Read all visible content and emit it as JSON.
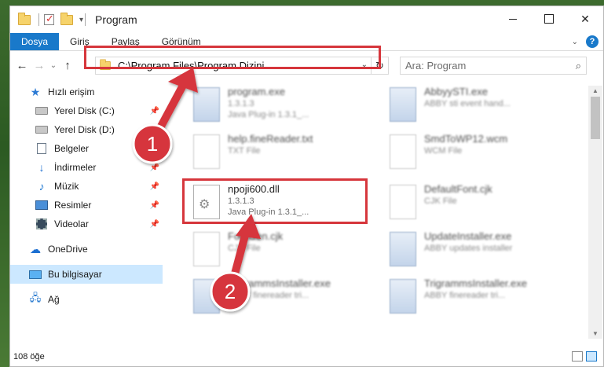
{
  "window": {
    "title": "Program"
  },
  "ribbon": {
    "tabs": [
      {
        "label": "Dosya"
      },
      {
        "label": "Giriş"
      },
      {
        "label": "Paylaş"
      },
      {
        "label": "Görünüm"
      }
    ]
  },
  "address": {
    "path": "C:\\Program Files\\Program Dizini"
  },
  "search": {
    "placeholder": "Ara: Program"
  },
  "navpane": {
    "items": [
      {
        "label": "Hızlı erişim",
        "icon": "star-icon"
      },
      {
        "label": "Yerel Disk (C:)",
        "icon": "drive-icon"
      },
      {
        "label": "Yerel Disk (D:)",
        "icon": "drive-icon"
      },
      {
        "label": "Belgeler",
        "icon": "document-icon"
      },
      {
        "label": "İndirmeler",
        "icon": "download-icon"
      },
      {
        "label": "Müzik",
        "icon": "music-icon"
      },
      {
        "label": "Resimler",
        "icon": "pictures-icon"
      },
      {
        "label": "Videolar",
        "icon": "video-icon"
      },
      {
        "label": "OneDrive",
        "icon": "cloud-icon"
      },
      {
        "label": "Bu bilgisayar",
        "icon": "computer-icon"
      },
      {
        "label": "Ağ",
        "icon": "network-icon"
      }
    ]
  },
  "files": [
    {
      "name": "program.exe",
      "line2": "1.3.1.3",
      "line3": "Java Plug-in 1.3.1_...",
      "blurred": true
    },
    {
      "name": "AbbyySTI.exe",
      "line2": "ABBY sti event hand...",
      "line3": "",
      "blurred": true
    },
    {
      "name": "help.fineReader.txt",
      "line2": "TXT File",
      "line3": "",
      "blurred": true
    },
    {
      "name": "SmdToWP12.wcm",
      "line2": "WCM File",
      "line3": "",
      "blurred": true
    },
    {
      "name": "npoji600.dll",
      "line2": "1.3.1.3",
      "line3": "Java Plug-in 1.3.1_...",
      "blurred": false
    },
    {
      "name": "DefaultFont.cjk",
      "line2": "CJK File",
      "line3": "",
      "blurred": true
    },
    {
      "name": "FontGen.cjk",
      "line2": "CJK File",
      "line3": "",
      "blurred": true
    },
    {
      "name": "UpdateInstaller.exe",
      "line2": "ABBY updates installer",
      "line3": "",
      "blurred": true
    },
    {
      "name": "TrigrammsInstaller.exe",
      "line2": "ABBY finereader tri...",
      "line3": "",
      "blurred": true
    },
    {
      "name": "TrigrammsInstaller.exe",
      "line2": "ABBY finereader tri...",
      "line3": "",
      "blurred": true
    }
  ],
  "status": {
    "count": "108 öğe"
  },
  "annotations": {
    "badge1": "1",
    "badge2": "2",
    "color": "#d6363c"
  }
}
